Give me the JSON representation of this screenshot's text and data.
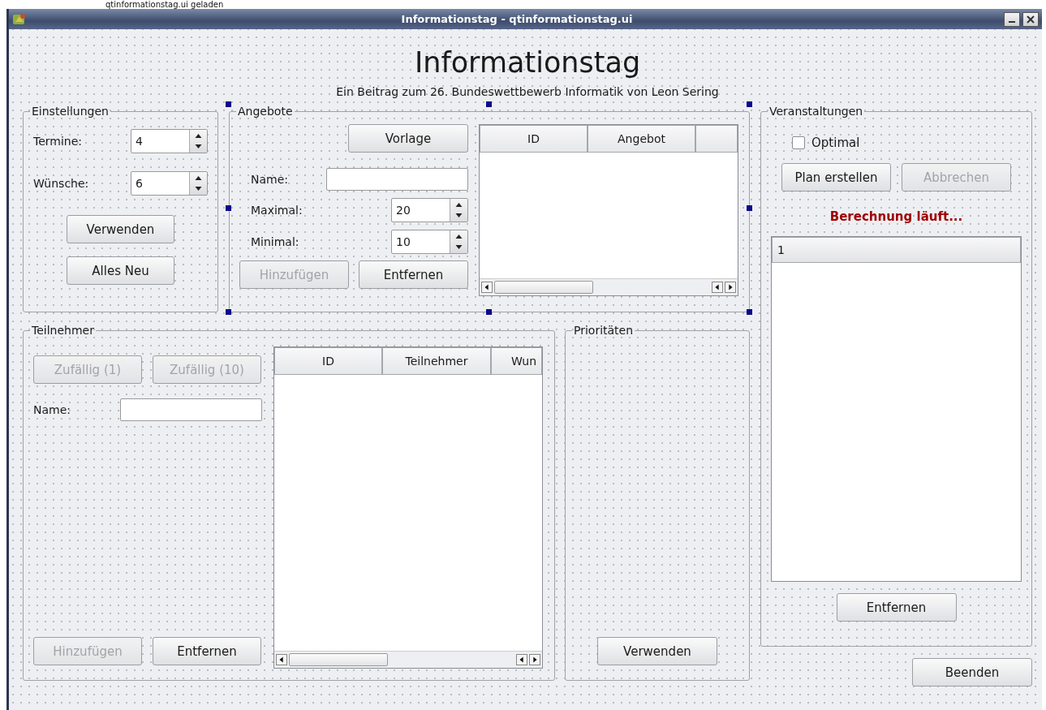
{
  "status_message": "qtinformationstag.ui geladen",
  "window": {
    "title": "Informationstag - qtinformationstag.ui"
  },
  "heading": "Informationstag",
  "subheading": "Ein Beitrag zum 26. Bundeswettbewerb Informatik von Leon Sering",
  "einstellungen": {
    "title": "Einstellungen",
    "fields": [
      {
        "label": "Termine:",
        "value": "4"
      },
      {
        "label": "Wünsche:",
        "value": "6"
      }
    ],
    "buttons": [
      {
        "label": "Verwenden",
        "disabled": false
      },
      {
        "label": "Alles Neu",
        "disabled": false
      }
    ]
  },
  "angebote": {
    "title": "Angebote",
    "selected": true,
    "template_button": {
      "label": "Vorlage",
      "disabled": false
    },
    "name_label": "Name:",
    "spinboxes": [
      {
        "label": "Maximal:",
        "value": "20"
      },
      {
        "label": "Minimal:",
        "value": "10"
      }
    ],
    "buttons": [
      {
        "label": "Hinzufügen",
        "disabled": true
      },
      {
        "label": "Entfernen",
        "disabled": false
      }
    ],
    "table": {
      "columns": [
        "ID",
        "Angebot"
      ]
    }
  },
  "teilnehmer": {
    "title": "Teilnehmer",
    "random_buttons": [
      {
        "label": "Zufällig (1)",
        "disabled": true
      },
      {
        "label": "Zufällig (10)",
        "disabled": true
      }
    ],
    "name_label": "Name:",
    "buttons": [
      {
        "label": "Hinzufügen",
        "disabled": true
      },
      {
        "label": "Entfernen",
        "disabled": false
      }
    ],
    "table": {
      "columns": [
        "ID",
        "Teilnehmer",
        "Wun"
      ]
    }
  },
  "prioritaeten": {
    "title": "Prioritäten",
    "button": {
      "label": "Verwenden",
      "disabled": false
    }
  },
  "veranstaltungen": {
    "title": "Veranstaltungen",
    "checkbox": {
      "label": "Optimal",
      "checked": false
    },
    "buttons": [
      {
        "label": "Plan erstellen",
        "disabled": false
      },
      {
        "label": "Abbrechen",
        "disabled": true
      }
    ],
    "status": "Berechnung läuft...",
    "list": {
      "header": "1"
    },
    "remove_button": {
      "label": "Entfernen",
      "disabled": false
    }
  },
  "close_button": {
    "label": "Beenden",
    "disabled": false
  }
}
